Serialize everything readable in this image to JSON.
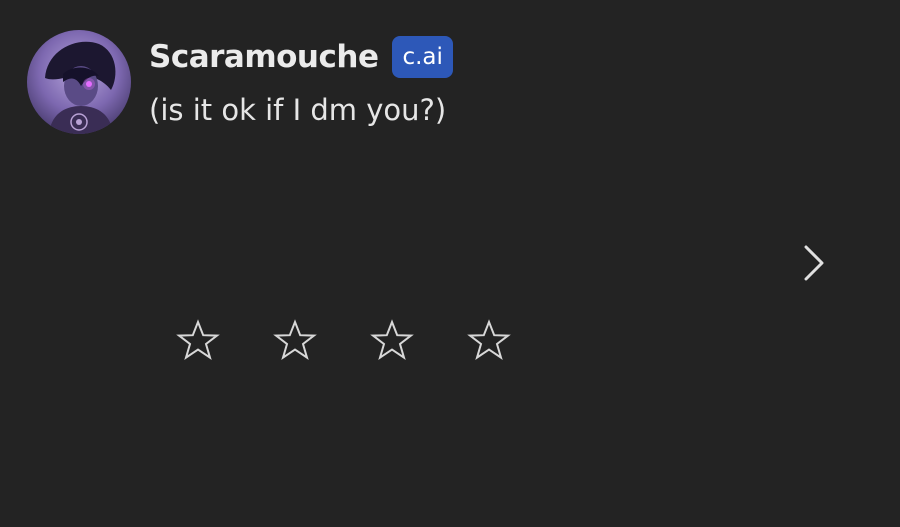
{
  "message": {
    "author_name": "Scaramouche",
    "badge_label": "c.ai",
    "text": "(is it ok if I dm you?)",
    "avatar_icon": "character-avatar",
    "next_icon": "chevron-right-icon"
  },
  "rating": {
    "stars": [
      {
        "icon": "star-outline-icon",
        "filled": false
      },
      {
        "icon": "star-outline-icon",
        "filled": false
      },
      {
        "icon": "star-outline-icon",
        "filled": false
      },
      {
        "icon": "star-outline-icon",
        "filled": false
      }
    ]
  },
  "colors": {
    "background": "#232323",
    "badge": "#2d58b8",
    "text": "#e9e9e9",
    "icon": "#d8d8d8"
  }
}
